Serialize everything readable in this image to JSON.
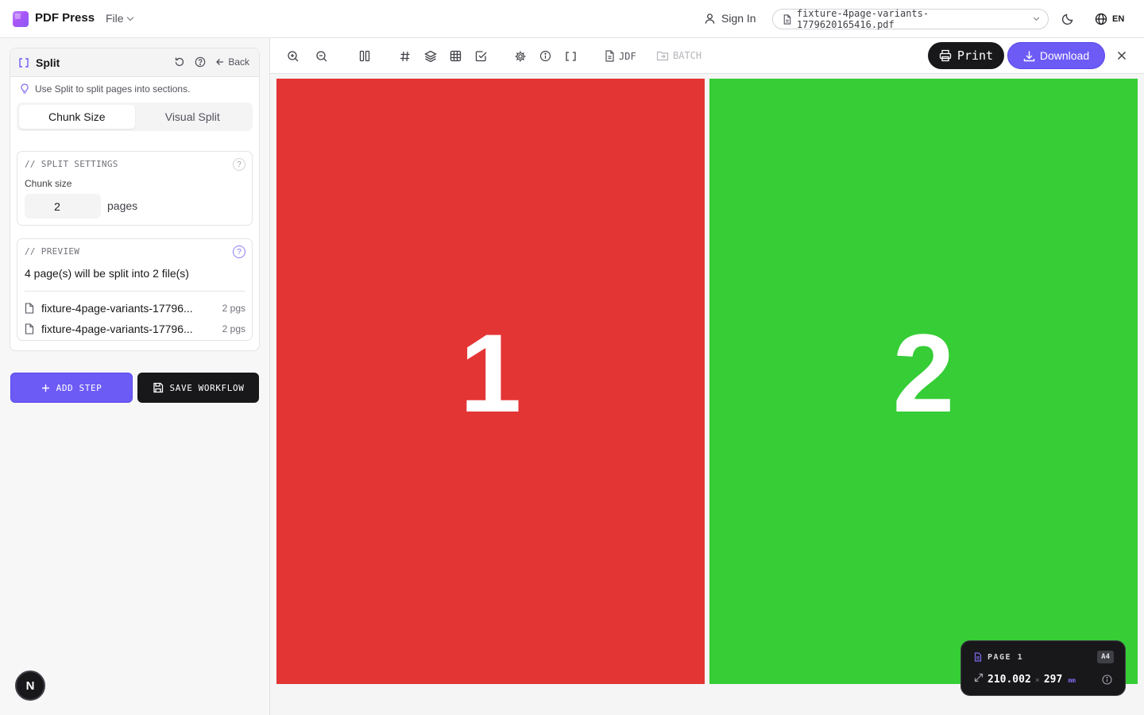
{
  "app": {
    "name": "PDF Press",
    "file_menu": "File"
  },
  "header": {
    "sign_in": "Sign In",
    "current_file": "fixture-4page-variants-1779620165416.pdf",
    "language": "EN"
  },
  "sidebar": {
    "tool_title": "Split",
    "back_label": "Back",
    "hint": "Use Split to split pages into sections.",
    "modes": [
      "Chunk Size",
      "Visual Split"
    ],
    "active_mode": "Chunk Size",
    "settings": {
      "section_label": "// SPLIT SETTINGS",
      "chunk_label": "Chunk size",
      "chunk_value": "2",
      "unit": "pages"
    },
    "preview": {
      "section_label": "// PREVIEW",
      "summary": "4 page(s) will be split into 2 file(s)",
      "files": [
        {
          "name": "fixture-4page-variants-17796...",
          "pages": "2 pgs"
        },
        {
          "name": "fixture-4page-variants-17796...",
          "pages": "2 pgs"
        }
      ]
    },
    "add_step": "ADD STEP",
    "save_workflow": "SAVE WORKFLOW",
    "badge": "N"
  },
  "toolbar": {
    "jdf": "JDF",
    "batch": "BATCH",
    "print": "Print",
    "download": "Download"
  },
  "pages": [
    {
      "number": "1",
      "color": "#e43535"
    },
    {
      "number": "2",
      "color": "#36cd36"
    }
  ],
  "page_info": {
    "label": "PAGE 1",
    "size_name": "A4",
    "width": "210.002",
    "height": "297",
    "unit": "mm"
  },
  "colors": {
    "accent": "#6d5bf6",
    "dark": "#18181b"
  }
}
